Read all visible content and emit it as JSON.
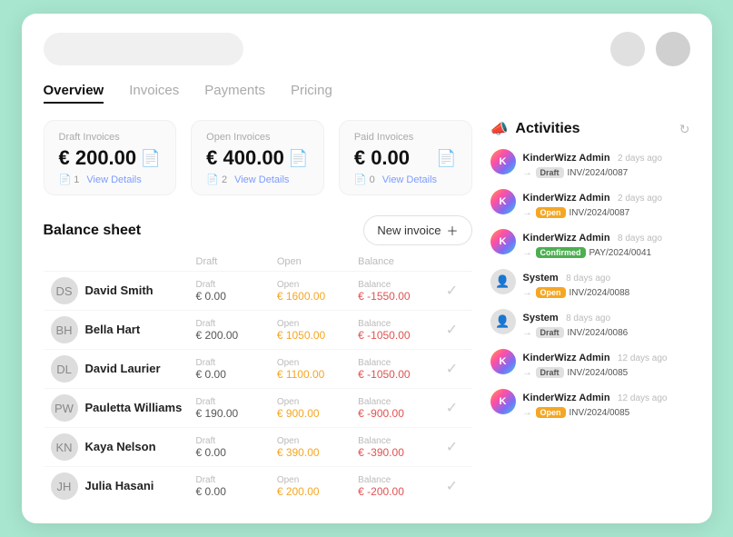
{
  "topbar": {
    "search_placeholder": ""
  },
  "tabs": [
    {
      "id": "overview",
      "label": "Overview",
      "active": true
    },
    {
      "id": "invoices",
      "label": "Invoices",
      "active": false
    },
    {
      "id": "payments",
      "label": "Payments",
      "active": false
    },
    {
      "id": "pricing",
      "label": "Pricing",
      "active": false
    }
  ],
  "stats": [
    {
      "label": "Draft Invoices",
      "amount": "€ 200.00",
      "count": "1",
      "link_label": "View Details"
    },
    {
      "label": "Open Invoices",
      "amount": "€ 400.00",
      "count": "2",
      "link_label": "View Details"
    },
    {
      "label": "Paid Invoices",
      "amount": "€ 0.00",
      "count": "0",
      "link_label": "View Details"
    }
  ],
  "balance_sheet": {
    "title": "Balance sheet",
    "new_invoice_label": "New invoice",
    "columns": [
      "",
      "Draft",
      "Open",
      "Balance",
      ""
    ],
    "rows": [
      {
        "name": "David Smith",
        "initials": "DS",
        "draft": "€ 0.00",
        "open": "€ 1600.00",
        "balance": "€ -1550.00",
        "open_color": "orange",
        "balance_color": "red"
      },
      {
        "name": "Bella Hart",
        "initials": "BH",
        "draft": "€ 200.00",
        "open": "€ 1050.00",
        "balance": "€ -1050.00",
        "open_color": "orange",
        "balance_color": "red"
      },
      {
        "name": "David Laurier",
        "initials": "DL",
        "draft": "€ 0.00",
        "open": "€ 1100.00",
        "balance": "€ -1050.00",
        "open_color": "orange",
        "balance_color": "red"
      },
      {
        "name": "Pauletta Williams",
        "initials": "PW",
        "draft": "€ 190.00",
        "open": "€ 900.00",
        "balance": "€ -900.00",
        "open_color": "orange",
        "balance_color": "red"
      },
      {
        "name": "Kaya Nelson",
        "initials": "KN",
        "draft": "€ 0.00",
        "open": "€ 390.00",
        "balance": "€ -390.00",
        "open_color": "orange",
        "balance_color": "red"
      },
      {
        "name": "Julia Hasani",
        "initials": "JH",
        "draft": "€ 0.00",
        "open": "€ 200.00",
        "balance": "€ -200.00",
        "open_color": "orange",
        "balance_color": "red"
      }
    ]
  },
  "activities": {
    "title": "Activities",
    "items": [
      {
        "user": "KinderWizz Admin",
        "time": "2 days ago",
        "type": "kw",
        "badge": "Draft",
        "badge_type": "draft",
        "invoice": "INV/2024/0087"
      },
      {
        "user": "KinderWizz Admin",
        "time": "2 days ago",
        "type": "kw",
        "badge": "Open",
        "badge_type": "open",
        "invoice": "INV/2024/0087"
      },
      {
        "user": "KinderWizz Admin",
        "time": "8 days ago",
        "type": "kw",
        "badge": "Confirmed",
        "badge_type": "confirmed",
        "invoice": "PAY/2024/0041"
      },
      {
        "user": "System",
        "time": "8 days ago",
        "type": "sys",
        "badge": "Open",
        "badge_type": "open",
        "invoice": "INV/2024/0088"
      },
      {
        "user": "System",
        "time": "8 days ago",
        "type": "sys",
        "badge": "Draft",
        "badge_type": "draft",
        "invoice": "INV/2024/0086"
      },
      {
        "user": "KinderWizz Admin",
        "time": "12 days ago",
        "type": "kw",
        "badge": "Draft",
        "badge_type": "draft",
        "invoice": "INV/2024/0085"
      },
      {
        "user": "KinderWizz Admin",
        "time": "12 days ago",
        "type": "kw",
        "badge": "Open",
        "badge_type": "open",
        "invoice": "INV/2024/0085"
      }
    ]
  }
}
